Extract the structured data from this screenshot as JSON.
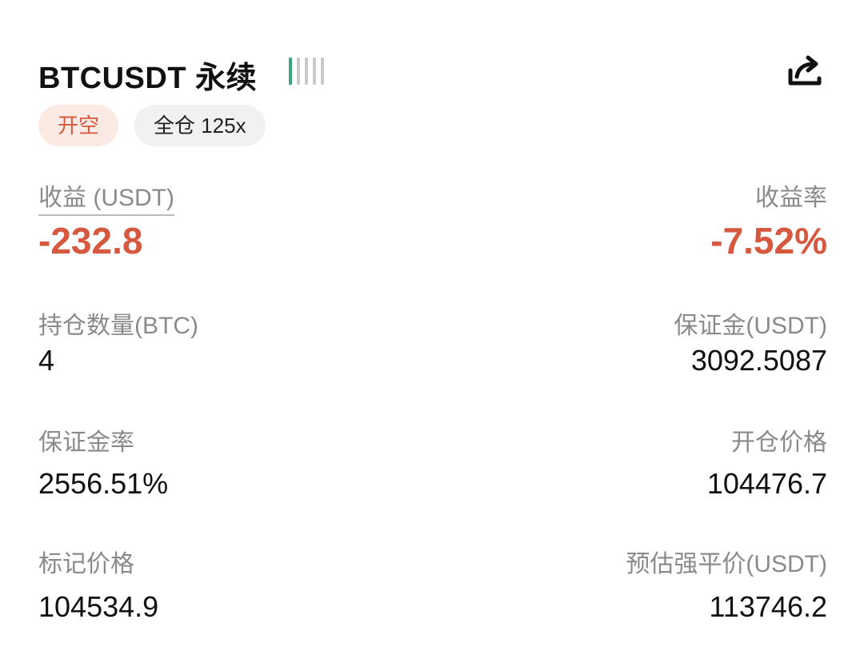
{
  "header": {
    "title": "BTCUSDT 永续",
    "strength_level": 1,
    "strength_total": 5,
    "share_icon": "share-icon"
  },
  "badges": {
    "side": "开空",
    "mode": "全仓 125x"
  },
  "pnl": {
    "label": "收益 (USDT)",
    "value": "-232.8",
    "rate_label": "收益率",
    "rate_value": "-7.52%"
  },
  "details": {
    "position_label": "持仓数量(BTC)",
    "position_value": "4",
    "margin_label": "保证金(USDT)",
    "margin_value": "3092.5087",
    "margin_rate_label": "保证金率",
    "margin_rate_value": "2556.51%",
    "entry_price_label": "开仓价格",
    "entry_price_value": "104476.7",
    "mark_price_label": "标记价格",
    "mark_price_value": "104534.9",
    "liq_price_label": "预估强平价(USDT)",
    "liq_price_value": "113746.2"
  },
  "colors": {
    "negative": "#d5583f",
    "strength_active": "#3aa57a",
    "strength_inactive": "#c9c9c9"
  }
}
